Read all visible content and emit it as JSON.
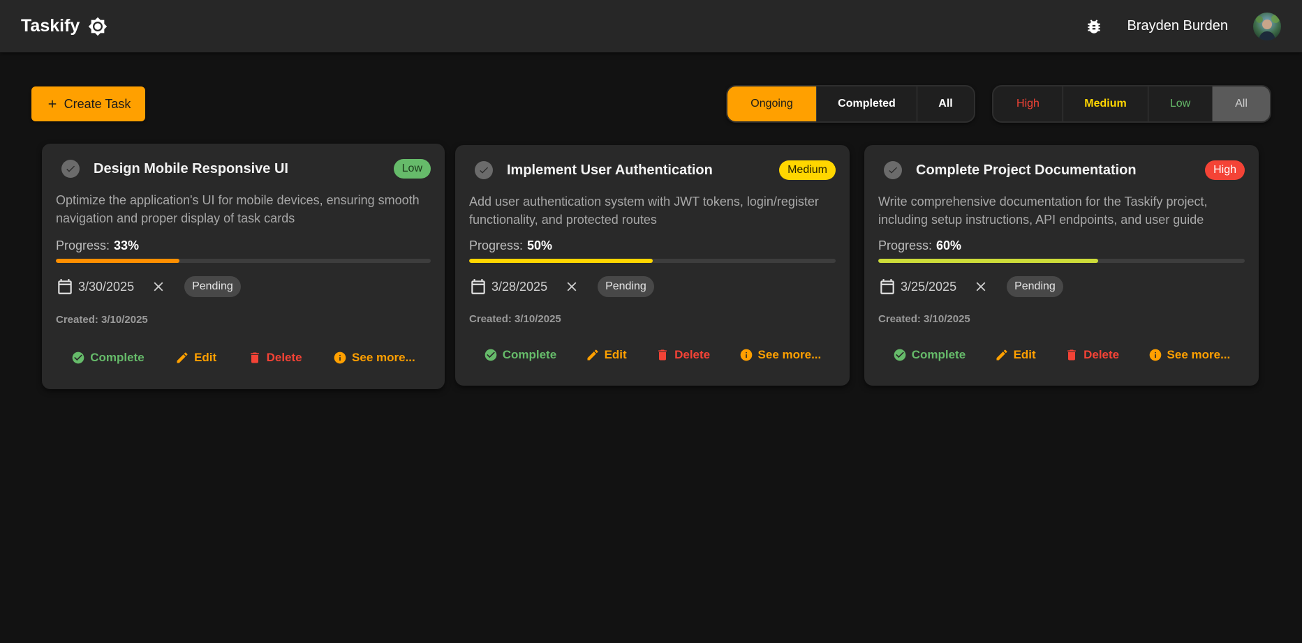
{
  "app": {
    "title": "Taskify"
  },
  "header": {
    "user_name": "Brayden Burden"
  },
  "toolbar": {
    "create_label": "Create Task"
  },
  "status_filter": [
    {
      "label": "Ongoing",
      "active": true
    },
    {
      "label": "Completed",
      "active": false
    },
    {
      "label": "All",
      "active": false
    }
  ],
  "priority_filter": [
    {
      "label": "High",
      "color": "#f44336",
      "active": false
    },
    {
      "label": "Medium",
      "color": "#ffd600",
      "active": false
    },
    {
      "label": "Low",
      "color": "#66bb6a",
      "active": false
    },
    {
      "label": "All",
      "color": "#cfcfcf",
      "active": true
    }
  ],
  "labels": {
    "progress": "Progress:",
    "complete": "Complete",
    "edit": "Edit",
    "delete": "Delete",
    "see_more": "See more..."
  },
  "colors": {
    "accent": "#ffa000",
    "complete": "#66bb6a",
    "delete": "#f44336",
    "edit": "#ffa000",
    "see_more": "#ffa000"
  },
  "tasks": [
    {
      "title": "Design Mobile Responsive UI",
      "priority": "Low",
      "priority_bg": "#66bb6a",
      "priority_fg": "#1b3b1b",
      "description": "Optimize the application's UI for mobile devices, ensuring smooth navigation and proper display of task cards",
      "progress_text": "33%",
      "progress": 0.33,
      "progress_color": "#ff8f00",
      "due_date": "3/30/2025",
      "status": "Pending",
      "created": "Created: 3/10/2025"
    },
    {
      "title": "Implement User Authentication",
      "priority": "Medium",
      "priority_bg": "#ffd600",
      "priority_fg": "#2a2400",
      "description": "Add user authentication system with JWT tokens, login/register functionality, and protected routes",
      "progress_text": "50%",
      "progress": 0.5,
      "progress_color": "#ffd600",
      "due_date": "3/28/2025",
      "status": "Pending",
      "created": "Created: 3/10/2025"
    },
    {
      "title": "Complete Project Documentation",
      "priority": "High",
      "priority_bg": "#f44336",
      "priority_fg": "#ffffff",
      "description": "Write comprehensive documentation for the Taskify project, including setup instructions, API endpoints, and user guide",
      "progress_text": "60%",
      "progress": 0.6,
      "progress_color": "#cddc39",
      "due_date": "3/25/2025",
      "status": "Pending",
      "created": "Created: 3/10/2025"
    }
  ]
}
